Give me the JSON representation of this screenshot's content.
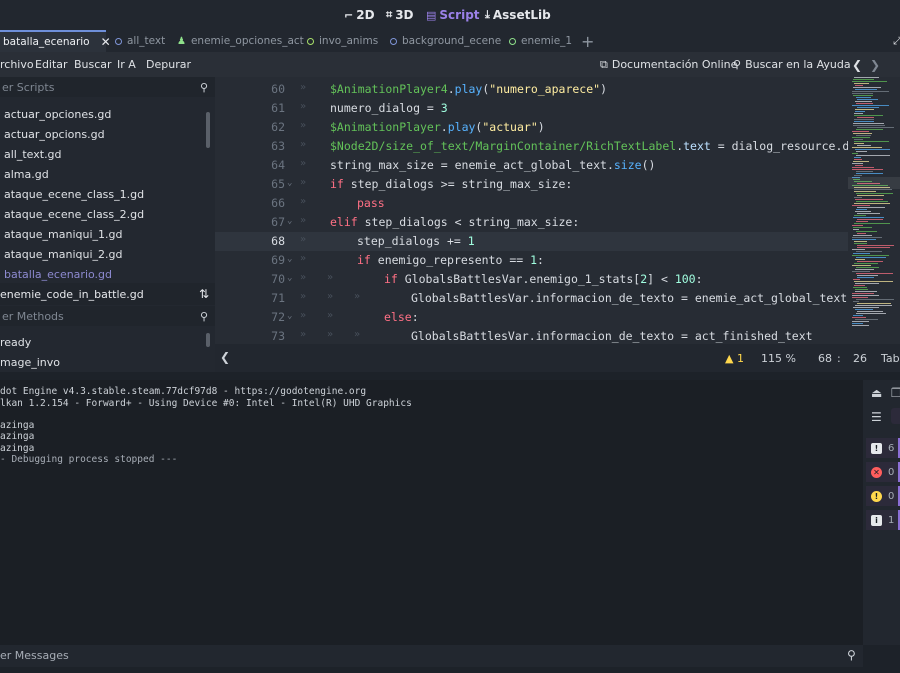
{
  "workspace": {
    "items": [
      {
        "icon": "⌐",
        "label": "2D"
      },
      {
        "icon": "⌗",
        "label": "3D"
      },
      {
        "icon": "▤",
        "label": "Script"
      },
      {
        "icon": "⤓",
        "label": "AssetLib"
      }
    ],
    "active": "Script"
  },
  "tabs": [
    {
      "label": "batalla_ecenario",
      "color": "#6e8fd9"
    },
    {
      "label": "all_text",
      "color": "#7f95d8"
    },
    {
      "label": "enemie_opciones_act",
      "color": "#8ee08a"
    },
    {
      "label": "invo_anims",
      "color": "#a8e06a"
    },
    {
      "label": "background_ecene",
      "color": "#7f95d8"
    },
    {
      "label": "enemie_1",
      "color": "#8ee08a"
    }
  ],
  "menubar": {
    "items": [
      "rchivo",
      "Editar",
      "Buscar",
      "Ir A",
      "Depurar"
    ],
    "docs": "Documentación Online",
    "help": "Buscar en la Ayuda"
  },
  "scripts_panel": {
    "filter_placeholder": "er Scripts",
    "items": [
      "actuar_opciones.gd",
      "actuar_opcions.gd",
      "all_text.gd",
      "alma.gd",
      "ataque_ecene_class_1.gd",
      "ataque_ecene_class_2.gd",
      "ataque_maniqui_1.gd",
      "ataque_maniqui_2.gd",
      "batalla_ecenario.gd"
    ],
    "current_file": "enemie_code_in_battle.gd"
  },
  "methods_panel": {
    "filter_placeholder": "er Methods",
    "items": [
      "ready",
      "mage_invo"
    ]
  },
  "editor": {
    "current_line": "68",
    "lines": [
      {
        "n": "60",
        "indent": 0,
        "code": [
          {
            "t": "$AnimationPlayer4",
            "c": "node"
          },
          {
            "t": ".",
            "c": ""
          },
          {
            "t": "play",
            "c": "fn"
          },
          {
            "t": "(",
            "c": ""
          },
          {
            "t": "\"numero_aparece\"",
            "c": "str"
          },
          {
            "t": ")",
            "c": ""
          }
        ]
      },
      {
        "n": "61",
        "indent": 0,
        "code": [
          {
            "t": "numero_dialog = ",
            "c": ""
          },
          {
            "t": "3",
            "c": "num"
          }
        ]
      },
      {
        "n": "62",
        "indent": 0,
        "code": [
          {
            "t": "$AnimationPlayer",
            "c": "node"
          },
          {
            "t": ".",
            "c": ""
          },
          {
            "t": "play",
            "c": "fn"
          },
          {
            "t": "(",
            "c": ""
          },
          {
            "t": "\"actuar\"",
            "c": "str"
          },
          {
            "t": ")",
            "c": ""
          }
        ]
      },
      {
        "n": "63",
        "indent": 0,
        "code": [
          {
            "t": "$Node2D/size_of_text/MarginContainer/RichTextLabel",
            "c": "node"
          },
          {
            "t": ".",
            "c": ""
          },
          {
            "t": "text",
            "c": "prop"
          },
          {
            "t": " = dialog_resource.di",
            "c": ""
          }
        ]
      },
      {
        "n": "64",
        "indent": 0,
        "code": [
          {
            "t": "string_max_size = enemie_act_global_text.",
            "c": ""
          },
          {
            "t": "size",
            "c": "fn"
          },
          {
            "t": "()",
            "c": ""
          }
        ]
      },
      {
        "n": "65",
        "indent": 0,
        "fold": true,
        "code": [
          {
            "t": "if",
            "c": "kw"
          },
          {
            "t": " step_dialogs >= string_max_size:",
            "c": ""
          }
        ]
      },
      {
        "n": "66",
        "indent": 1,
        "code": [
          {
            "t": "pass",
            "c": "kw"
          }
        ]
      },
      {
        "n": "67",
        "indent": 0,
        "fold": true,
        "code": [
          {
            "t": "elif",
            "c": "kw"
          },
          {
            "t": " step_dialogs < string_max_size:",
            "c": ""
          }
        ]
      },
      {
        "n": "68",
        "indent": 1,
        "code": [
          {
            "t": "step_dialogs += ",
            "c": ""
          },
          {
            "t": "1",
            "c": "num"
          }
        ]
      },
      {
        "n": "69",
        "indent": 1,
        "fold": true,
        "code": [
          {
            "t": "if",
            "c": "kw"
          },
          {
            "t": " enemigo_represento == ",
            "c": ""
          },
          {
            "t": "1",
            "c": "num"
          },
          {
            "t": ":",
            "c": ""
          }
        ]
      },
      {
        "n": "70",
        "indent": 2,
        "fold": true,
        "code": [
          {
            "t": "if",
            "c": "kw"
          },
          {
            "t": " GlobalsBattlesVar.enemigo_1_stats[",
            "c": ""
          },
          {
            "t": "2",
            "c": "num"
          },
          {
            "t": "] < ",
            "c": ""
          },
          {
            "t": "100",
            "c": "num"
          },
          {
            "t": ":",
            "c": ""
          }
        ]
      },
      {
        "n": "71",
        "indent": 3,
        "code": [
          {
            "t": "GlobalsBattlesVar.informacion_de_texto = enemie_act_global_text[",
            "c": ""
          }
        ]
      },
      {
        "n": "72",
        "indent": 2,
        "fold": true,
        "code": [
          {
            "t": "else",
            "c": "kw"
          },
          {
            "t": ":",
            "c": ""
          }
        ]
      },
      {
        "n": "73",
        "indent": 3,
        "code": [
          {
            "t": "GlobalsBattlesVar.informacion_de_texto = act_finished_text",
            "c": ""
          }
        ]
      }
    ]
  },
  "status": {
    "warnings": "1",
    "zoom": "115 %",
    "line": "68",
    "col": "26",
    "indent_mode": "Tab"
  },
  "output": {
    "lines": [
      "dot Engine v4.3.stable.steam.77dcf97d8 - https://godotengine.org",
      "lkan 1.2.154 - Forward+ - Using Device #0: Intel - Intel(R) UHD Graphics",
      "",
      "azinga",
      "azinga",
      "azinga",
      "- Debugging process stopped ---"
    ],
    "filter_placeholder": "er Messages",
    "counts": [
      {
        "icon": "!",
        "value": "6",
        "color": "#e6e8ec"
      },
      {
        "icon": "✕",
        "value": "0",
        "color": "#ff5d5d"
      },
      {
        "icon": "!",
        "value": "0",
        "color": "#ffd84d"
      },
      {
        "icon": "i",
        "value": "1",
        "color": "#e6e8ec"
      }
    ]
  }
}
